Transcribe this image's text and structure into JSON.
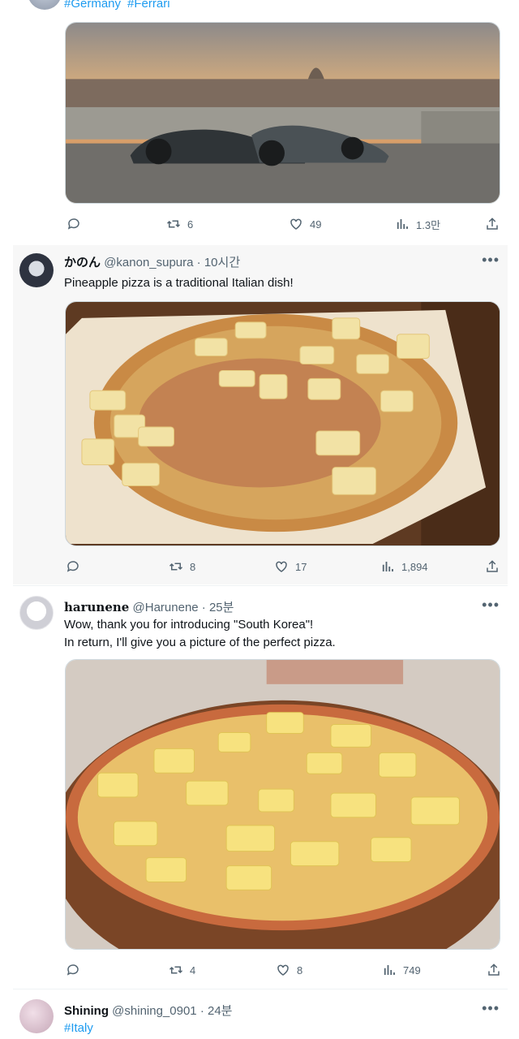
{
  "top_partial": {
    "hashtags": [
      "#Germany",
      "#Ferrari"
    ],
    "stats": {
      "replies": "",
      "retweets": "6",
      "likes": "49",
      "views": "1.3만"
    }
  },
  "tweet1": {
    "name": "かのん",
    "handle": "@kanon_supura",
    "time": "· 10시간",
    "text": "Pineapple pizza is a traditional Italian dish!",
    "stats": {
      "replies": "",
      "retweets": "8",
      "likes": "17",
      "views": "1,894"
    }
  },
  "tweet2": {
    "name": "harunene",
    "handle": "@Harunene",
    "time": "· 25분",
    "text_line1": "Wow, thank you for introducing \"South Korea\"!",
    "text_line2": "In return, I'll give you a picture of the perfect pizza.",
    "stats": {
      "replies": "",
      "retweets": "4",
      "likes": "8",
      "views": "749"
    }
  },
  "tweet3": {
    "name": "Shining",
    "handle": "@shining_0901",
    "time": "· 24분",
    "hashtag": "#Italy"
  },
  "icons": {
    "reply": "reply-icon",
    "retweet": "retweet-icon",
    "like": "heart-icon",
    "views": "views-icon",
    "share": "share-icon",
    "more": "more-icon"
  },
  "colors": {
    "link": "#1d9bf0",
    "muted": "#536471",
    "text": "#0f1419"
  }
}
